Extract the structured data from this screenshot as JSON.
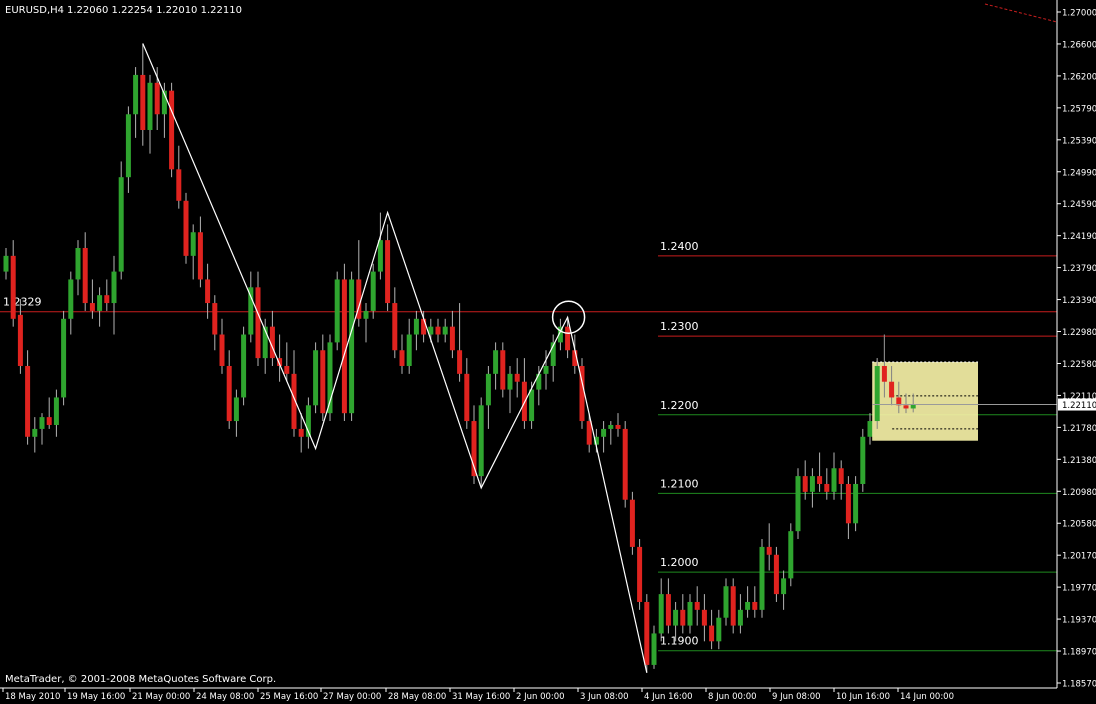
{
  "header": {
    "symbol_tf": "EURUSD,H4",
    "ohlc": "1.22060 1.22254 1.22010 1.22110"
  },
  "footer": {
    "copyright": "MetaTrader, © 2001-2008 MetaQuotes Software Corp."
  },
  "colors": {
    "background": "#000000",
    "axis": "#ffffff",
    "bull_candle": "#2fa52f",
    "bear_candle": "#e0231f",
    "wick": "#b4b4b4",
    "resistance_line": "#c81e1e",
    "support_line": "#1f8a1f",
    "pattern_line": "#ffffff",
    "highlight_box": "#f5f0a6"
  },
  "chart_data": {
    "type": "candlestick",
    "symbol": "EURUSD",
    "timeframe": "H4",
    "current_price": "1.22110",
    "ylim": [
      1.1857,
      1.271
    ],
    "y_ticks": [
      "1.27000",
      "1.26600",
      "1.26200",
      "1.25790",
      "1.25390",
      "1.24990",
      "1.24590",
      "1.24190",
      "1.23790",
      "1.23390",
      "1.22980",
      "1.22580",
      "1.22110",
      "1.21780",
      "1.21380",
      "1.20980",
      "1.20580",
      "1.20170",
      "1.19770",
      "1.19370",
      "1.18970",
      "1.18570"
    ],
    "x_ticks": [
      "18 May 2010",
      "19 May 16:00",
      "21 May 00:00",
      "24 May 08:00",
      "25 May 16:00",
      "27 May 00:00",
      "28 May 08:00",
      "31 May 16:00",
      "2 Jun 00:00",
      "3 Jun 08:00",
      "4 Jun 16:00",
      "8 Jun 00:00",
      "9 Jun 08:00",
      "10 Jun 16:00",
      "14 Jun 00:00"
    ],
    "price_levels": [
      {
        "label": "1.2400",
        "value": 1.24,
        "kind": "resistance"
      },
      {
        "label": "1.2300",
        "value": 1.2298,
        "kind": "resistance"
      },
      {
        "label": "1.2200",
        "value": 1.2198,
        "kind": "support"
      },
      {
        "label": "1.2100",
        "value": 1.2098,
        "kind": "support"
      },
      {
        "label": "1.2000",
        "value": 1.1998,
        "kind": "support"
      },
      {
        "label": "1.1900",
        "value": 1.1898,
        "kind": "support"
      }
    ],
    "horizontal_line": {
      "label": "1.2329",
      "value": 1.2329
    },
    "zigzag_pattern": [
      {
        "bar": 19,
        "price": 1.267
      },
      {
        "bar": 43,
        "price": 1.2155
      },
      {
        "bar": 53,
        "price": 1.2455
      },
      {
        "bar": 66,
        "price": 1.2105
      },
      {
        "bar": 78,
        "price": 1.2322
      },
      {
        "bar": 89,
        "price": 1.187
      }
    ],
    "circle_marker": {
      "bar": 78,
      "price": 1.2322
    },
    "candles": [
      [
        1.238,
        1.241,
        1.237,
        1.24
      ],
      [
        1.24,
        1.242,
        1.231,
        1.232
      ],
      [
        1.2325,
        1.2345,
        1.225,
        1.226
      ],
      [
        1.226,
        1.228,
        1.216,
        1.217
      ],
      [
        1.217,
        1.2195,
        1.215,
        1.218
      ],
      [
        1.218,
        1.22,
        1.216,
        1.2195
      ],
      [
        1.2195,
        1.222,
        1.218,
        1.2185
      ],
      [
        1.2185,
        1.223,
        1.217,
        1.222
      ],
      [
        1.222,
        1.233,
        1.221,
        1.232
      ],
      [
        1.232,
        1.238,
        1.23,
        1.237
      ],
      [
        1.237,
        1.242,
        1.235,
        1.241
      ],
      [
        1.241,
        1.243,
        1.233,
        1.234
      ],
      [
        1.234,
        1.237,
        1.232,
        1.233
      ],
      [
        1.233,
        1.236,
        1.231,
        1.235
      ],
      [
        1.235,
        1.237,
        1.233,
        1.234
      ],
      [
        1.234,
        1.24,
        1.23,
        1.238
      ],
      [
        1.238,
        1.252,
        1.237,
        1.25
      ],
      [
        1.25,
        1.259,
        1.248,
        1.258
      ],
      [
        1.258,
        1.264,
        1.255,
        1.263
      ],
      [
        1.263,
        1.267,
        1.254,
        1.256
      ],
      [
        1.256,
        1.263,
        1.253,
        1.262
      ],
      [
        1.262,
        1.264,
        1.256,
        1.258
      ],
      [
        1.258,
        1.262,
        1.255,
        1.261
      ],
      [
        1.261,
        1.262,
        1.25,
        1.251
      ],
      [
        1.251,
        1.254,
        1.246,
        1.247
      ],
      [
        1.247,
        1.248,
        1.239,
        1.24
      ],
      [
        1.24,
        1.244,
        1.237,
        1.243
      ],
      [
        1.243,
        1.245,
        1.236,
        1.237
      ],
      [
        1.237,
        1.239,
        1.232,
        1.234
      ],
      [
        1.234,
        1.235,
        1.228,
        1.23
      ],
      [
        1.23,
        1.232,
        1.225,
        1.226
      ],
      [
        1.226,
        1.228,
        1.218,
        1.219
      ],
      [
        1.219,
        1.223,
        1.217,
        1.222
      ],
      [
        1.222,
        1.231,
        1.221,
        1.23
      ],
      [
        1.23,
        1.238,
        1.229,
        1.236
      ],
      [
        1.236,
        1.238,
        1.226,
        1.227
      ],
      [
        1.227,
        1.232,
        1.225,
        1.231
      ],
      [
        1.231,
        1.233,
        1.226,
        1.227
      ],
      [
        1.227,
        1.23,
        1.224,
        1.226
      ],
      [
        1.226,
        1.229,
        1.224,
        1.225
      ],
      [
        1.225,
        1.228,
        1.217,
        1.218
      ],
      [
        1.218,
        1.22,
        1.215,
        1.217
      ],
      [
        1.217,
        1.222,
        1.2155,
        1.221
      ],
      [
        1.221,
        1.229,
        1.22,
        1.228
      ],
      [
        1.228,
        1.23,
        1.219,
        1.22
      ],
      [
        1.22,
        1.23,
        1.219,
        1.229
      ],
      [
        1.229,
        1.238,
        1.228,
        1.237
      ],
      [
        1.237,
        1.239,
        1.219,
        1.22
      ],
      [
        1.22,
        1.238,
        1.219,
        1.237
      ],
      [
        1.237,
        1.242,
        1.231,
        1.232
      ],
      [
        1.232,
        1.234,
        1.229,
        1.233
      ],
      [
        1.233,
        1.239,
        1.232,
        1.238
      ],
      [
        1.238,
        1.2455,
        1.237,
        1.242
      ],
      [
        1.242,
        1.244,
        1.233,
        1.234
      ],
      [
        1.234,
        1.236,
        1.227,
        1.228
      ],
      [
        1.228,
        1.23,
        1.225,
        1.226
      ],
      [
        1.226,
        1.232,
        1.225,
        1.23
      ],
      [
        1.23,
        1.233,
        1.228,
        1.232
      ],
      [
        1.232,
        1.233,
        1.229,
        1.23
      ],
      [
        1.23,
        1.232,
        1.229,
        1.231
      ],
      [
        1.231,
        1.232,
        1.229,
        1.23
      ],
      [
        1.23,
        1.232,
        1.229,
        1.231
      ],
      [
        1.231,
        1.233,
        1.227,
        1.228
      ],
      [
        1.228,
        1.234,
        1.224,
        1.225
      ],
      [
        1.225,
        1.227,
        1.218,
        1.219
      ],
      [
        1.219,
        1.221,
        1.211,
        1.212
      ],
      [
        1.212,
        1.222,
        1.2105,
        1.221
      ],
      [
        1.221,
        1.226,
        1.218,
        1.225
      ],
      [
        1.225,
        1.229,
        1.223,
        1.228
      ],
      [
        1.228,
        1.229,
        1.222,
        1.223
      ],
      [
        1.223,
        1.226,
        1.22,
        1.225
      ],
      [
        1.225,
        1.227,
        1.222,
        1.224
      ],
      [
        1.224,
        1.227,
        1.218,
        1.219
      ],
      [
        1.219,
        1.224,
        1.218,
        1.223
      ],
      [
        1.223,
        1.226,
        1.221,
        1.225
      ],
      [
        1.225,
        1.228,
        1.223,
        1.226
      ],
      [
        1.226,
        1.23,
        1.224,
        1.229
      ],
      [
        1.229,
        1.232,
        1.228,
        1.231
      ],
      [
        1.231,
        1.2322,
        1.227,
        1.228
      ],
      [
        1.228,
        1.23,
        1.225,
        1.226
      ],
      [
        1.226,
        1.227,
        1.218,
        1.219
      ],
      [
        1.219,
        1.22,
        1.215,
        1.216
      ],
      [
        1.216,
        1.218,
        1.215,
        1.217
      ],
      [
        1.217,
        1.219,
        1.215,
        1.218
      ],
      [
        1.218,
        1.219,
        1.216,
        1.2185
      ],
      [
        1.2185,
        1.22,
        1.217,
        1.218
      ],
      [
        1.218,
        1.219,
        1.208,
        1.209
      ],
      [
        1.209,
        1.21,
        1.202,
        1.203
      ],
      [
        1.203,
        1.204,
        1.195,
        1.196
      ],
      [
        1.196,
        1.197,
        1.187,
        1.188
      ],
      [
        1.188,
        1.193,
        1.1875,
        1.192
      ],
      [
        1.192,
        1.199,
        1.191,
        1.197
      ],
      [
        1.197,
        1.199,
        1.192,
        1.193
      ],
      [
        1.193,
        1.196,
        1.191,
        1.195
      ],
      [
        1.195,
        1.197,
        1.192,
        1.193
      ],
      [
        1.193,
        1.197,
        1.192,
        1.196
      ],
      [
        1.196,
        1.198,
        1.193,
        1.195
      ],
      [
        1.195,
        1.197,
        1.191,
        1.193
      ],
      [
        1.193,
        1.195,
        1.19,
        1.191
      ],
      [
        1.191,
        1.195,
        1.19,
        1.194
      ],
      [
        1.194,
        1.199,
        1.193,
        1.198
      ],
      [
        1.198,
        1.199,
        1.192,
        1.193
      ],
      [
        1.193,
        1.197,
        1.192,
        1.195
      ],
      [
        1.195,
        1.198,
        1.194,
        1.196
      ],
      [
        1.196,
        1.198,
        1.194,
        1.195
      ],
      [
        1.195,
        1.204,
        1.194,
        1.203
      ],
      [
        1.203,
        1.206,
        1.2,
        1.202
      ],
      [
        1.202,
        1.203,
        1.196,
        1.197
      ],
      [
        1.197,
        1.2,
        1.195,
        1.199
      ],
      [
        1.199,
        1.206,
        1.198,
        1.205
      ],
      [
        1.205,
        1.213,
        1.204,
        1.212
      ],
      [
        1.212,
        1.214,
        1.209,
        1.21
      ],
      [
        1.21,
        1.213,
        1.208,
        1.212
      ],
      [
        1.212,
        1.215,
        1.21,
        1.211
      ],
      [
        1.211,
        1.213,
        1.209,
        1.21
      ],
      [
        1.21,
        1.215,
        1.209,
        1.213
      ],
      [
        1.213,
        1.214,
        1.209,
        1.211
      ],
      [
        1.211,
        1.212,
        1.204,
        1.206
      ],
      [
        1.206,
        1.212,
        1.205,
        1.211
      ],
      [
        1.211,
        1.218,
        1.21,
        1.217
      ],
      [
        1.217,
        1.22,
        1.216,
        1.219
      ],
      [
        1.219,
        1.227,
        1.218,
        1.226
      ],
      [
        1.226,
        1.23,
        1.222,
        1.224
      ],
      [
        1.224,
        1.226,
        1.221,
        1.222
      ],
      [
        1.222,
        1.224,
        1.22,
        1.221
      ],
      [
        1.221,
        1.2225,
        1.22,
        1.2206
      ],
      [
        1.2206,
        1.2225,
        1.2201,
        1.2211
      ]
    ]
  }
}
